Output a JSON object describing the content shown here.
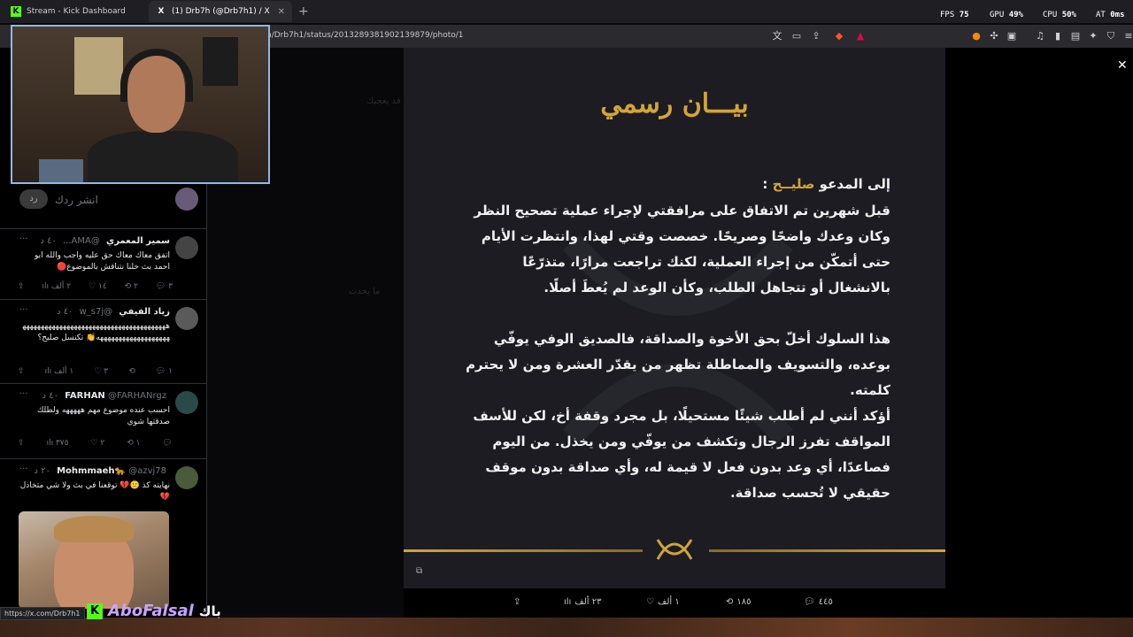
{
  "browser": {
    "tabs": [
      {
        "title": "Stream - Kick Dashboard",
        "favicon": "K"
      },
      {
        "title": "(1) Drb7h (@Drb7h1) / X",
        "favicon": "X"
      }
    ],
    "new_tab": "+",
    "url": "n/Drb7h1/status/2013289381902139879/photo/1",
    "overlay_stats": {
      "fps_label": "FPS",
      "fps": "75",
      "gpu_label": "GPU",
      "gpu": "49%",
      "cpu_label": "CPU",
      "cpu": "50%",
      "bat_label": "AT",
      "bat": "0ms"
    }
  },
  "feed": {
    "reply_button": "رد",
    "reply_placeholder": "انشر ردك",
    "tweets": [
      {
        "name": "سمير المعمري",
        "handle": "@AMA...",
        "time": "٤٠ د",
        "text": "اتفق معاك معاك حق عليه واجب والله ابو احمد بث خلنا نتناقش بالموضوع🔴",
        "replies": "٣",
        "retweets": "٢",
        "likes": "١٤",
        "views": "٢ ألف"
      },
      {
        "name": "زياد الفيفي",
        "handle": "@w_s7j",
        "time": "٤٠ د",
        "text": "هههههههههههههههههههههههههههههههههههههههههههههههههههههههههههه👏 تكنسل صليح؟",
        "replies": "١",
        "retweets": "",
        "likes": "٣",
        "views": "١ ألف"
      },
      {
        "name": "FARHAN",
        "handle": "@FARHANrgz",
        "time": "٤٠ د",
        "text": "احسب عنده موضوع مهم هههههه ولطلك صدقتها شوي",
        "replies": "",
        "retweets": "١",
        "likes": "٢",
        "views": "٣٧٥"
      },
      {
        "name": "Mohmmaeh🐆",
        "handle": "@azvj78",
        "time": "٢٠ د",
        "text": "نهايته كذ 🙂💔 توقعنا في بث ولا شي متخاذل 💔",
        "replies": "",
        "retweets": "",
        "likes": "",
        "views": ""
      }
    ]
  },
  "statement": {
    "title": "بيـــان رسمي",
    "addressee_prefix": "إلى المدعو",
    "addressee_name": "صليــح",
    "addressee_suffix": ":",
    "para1": "قبل شهرين تم الاتفاق على مرافقتي لإجراء عملية تصحيح النظر وكان وعدك واضحًا وصريحًا. خصصت وقتي لهذا، وانتظرت الأيام حتى أتمكّن من إجراء العملية، لكنك تراجعت مرارًا، متذرّعًا بالانشغال أو تتجاهل الطلب، وكأن الوعد لم يُعطَ أصلًا.",
    "para2": "هذا السلوك أخلّ بحق الأخوة والصداقة، فالصديق الوفي يوفّي بوعده، والتسويف والمماطلة تظهر من يقدّر العشرة ومن لا يحترم كلمته.",
    "para3": "أؤكد أنني لم أطلب شيئًا مستحيلًا، بل مجرد وقفة أخ، لكن للأسف المواقف تفرز الرجال وتكشف من يوفّي ومن يخذل. من اليوم فصاعدًا، أي وعد بدون فعل لا قيمة له، وأي صداقة بدون موقف حقيقي لا تُحسب صداقة."
  },
  "image_actions": {
    "replies": "٤٤٥",
    "retweets": "١٨٥",
    "likes": "١ ألف",
    "views": "٢٣ ألف"
  },
  "status_url": "https://x.com/Drb7h1",
  "stream_overlay": {
    "name": "AboFalsal",
    "arabic": "باك"
  },
  "colors": {
    "gold": "#d4a437",
    "kick_green": "#53fc18"
  }
}
